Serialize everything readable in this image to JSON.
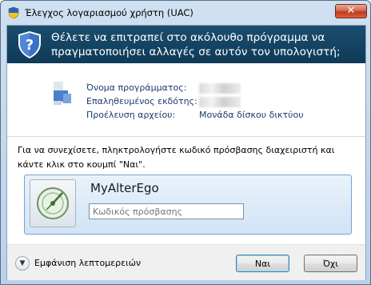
{
  "window": {
    "title": "Έλεγχος λογαριασμού χρήστη (UAC)",
    "close_glyph": "✕"
  },
  "banner": {
    "text": "Θέλετε να επιτραπεί στο ακόλουθο πρόγραμμα να πραγματοποιήσει αλλαγές σε αυτόν τον υπολογιστή;",
    "background_color": "#174566"
  },
  "details": {
    "rows": [
      {
        "label": "Όνομα προγράμματος:",
        "value": ""
      },
      {
        "label": "Επαληθευμένος εκδότης:",
        "value": ""
      },
      {
        "label": "Προέλευση αρχείου:",
        "value": "Μονάδα δίσκου δικτύου"
      }
    ]
  },
  "prompt": "Για να συνεχίσετε, πληκτρολογήστε κωδικό πρόσβασης διαχειριστή και κάντε κλικ στο κουμπί \"Ναι\".",
  "credential": {
    "username": "MyAlterEgo",
    "password_placeholder": "Κωδικός πρόσβασης",
    "password_value": ""
  },
  "footer": {
    "show_details_label": "Εμφάνιση λεπτομερειών",
    "yes_label": "Ναι",
    "no_label": "Όχι"
  },
  "icons": {
    "title": "uac-shield-icon",
    "banner": "uac-shield-icon",
    "program": "program-icon",
    "user_tile": "user-tile-icon",
    "expand": "chevron-down-icon"
  }
}
